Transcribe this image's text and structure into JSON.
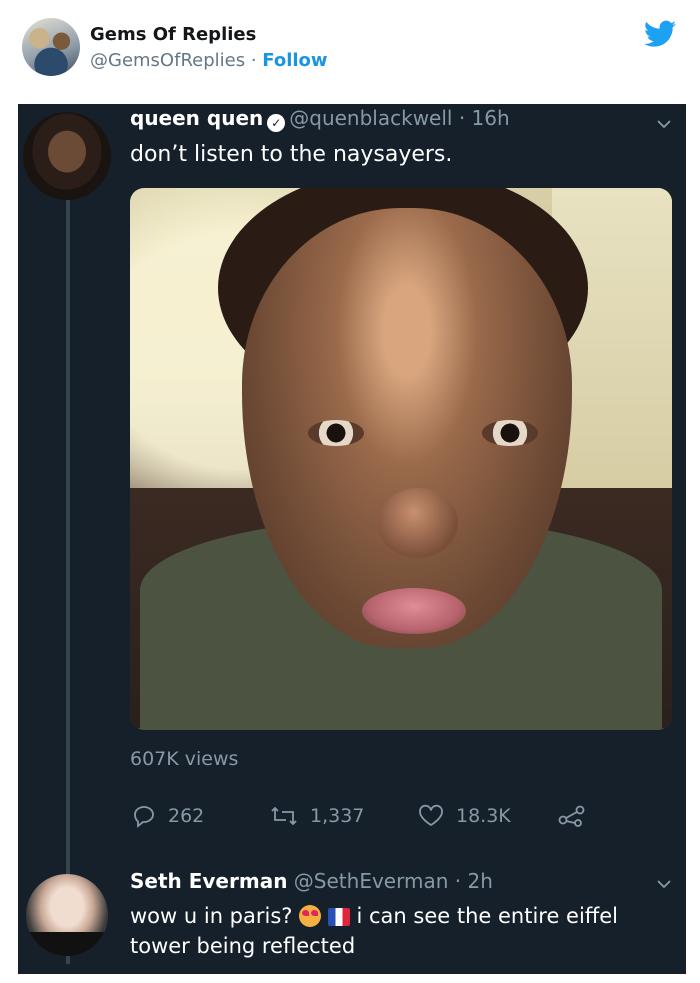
{
  "embed": {
    "account_name": "Gems Of Replies",
    "handle": "@GemsOfReplies",
    "separator": " · ",
    "follow_label": "Follow"
  },
  "tweet": {
    "author_name": "queen quen",
    "handle": "@quenblackwell",
    "separator": " · ",
    "time": "16h",
    "text": "don’t listen to the naysayers.",
    "views": "607K views",
    "actions": {
      "replies": "262",
      "retweets": "1,337",
      "likes": "18.3K"
    }
  },
  "reply": {
    "author_name": "Seth Everman",
    "handle": "@SethEverman",
    "separator": " · ",
    "time": "2h",
    "text_before": "wow u in paris? ",
    "text_after": " i can see the entire eiffel tower being reflected"
  },
  "colors": {
    "background_dark": "#15202b",
    "muted": "#8899a6",
    "twitter_blue": "#1da1f2",
    "thread_line": "#38444d"
  },
  "icons": [
    "twitter-bird-icon",
    "verified-icon",
    "chevron-down-icon",
    "reply-icon",
    "retweet-icon",
    "like-icon",
    "share-icon",
    "heart-eyes-emoji",
    "france-flag-emoji"
  ]
}
